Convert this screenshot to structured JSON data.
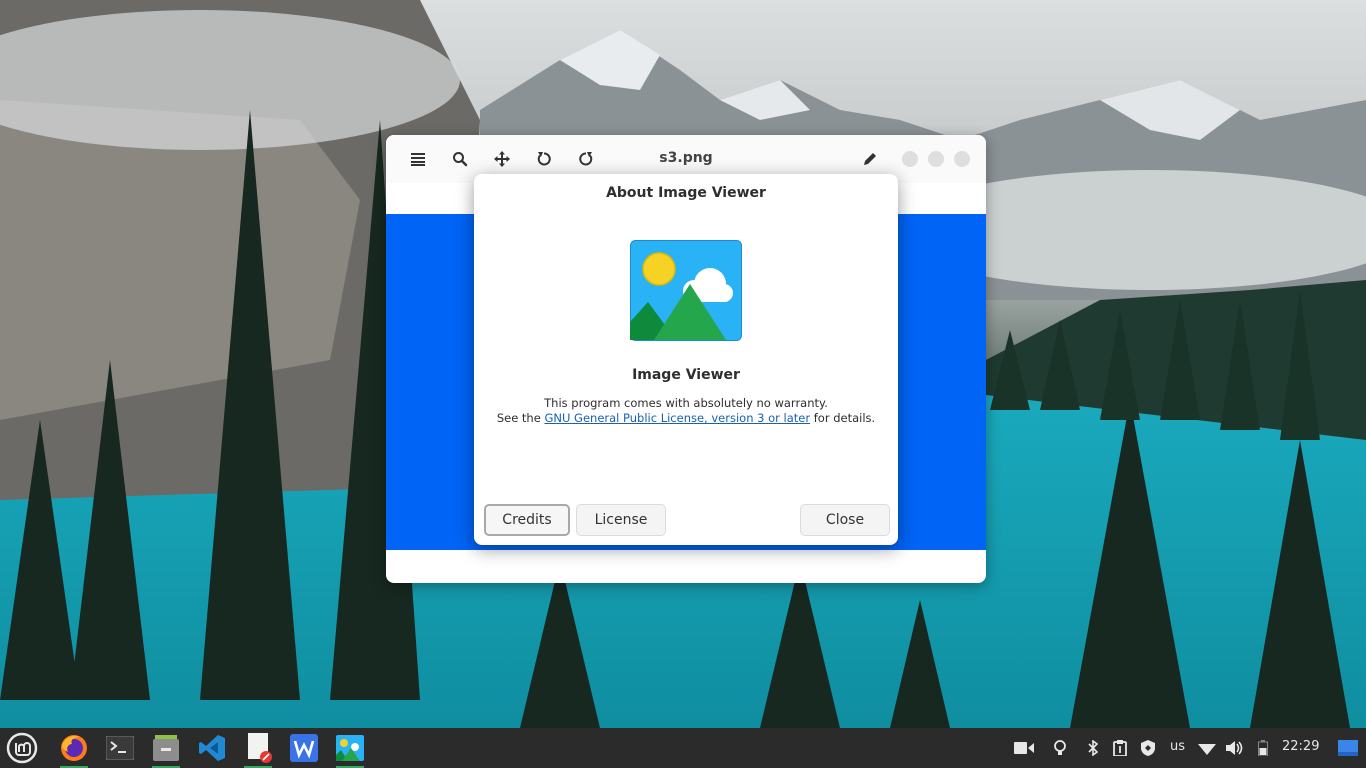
{
  "viewer": {
    "title": "s3.png",
    "toolbar": [
      "menu-icon",
      "search-icon",
      "move-icon",
      "rotate-left-icon",
      "rotate-right-icon",
      "edit-icon"
    ],
    "canvas_color": "#0064f6"
  },
  "about_dialog": {
    "title": "About Image Viewer",
    "app_name": "Image Viewer",
    "warranty_line": "This program comes with absolutely no warranty.",
    "license_prefix": "See the ",
    "license_link": "GNU General Public License, version 3 or later",
    "license_suffix": " for details.",
    "buttons": {
      "credits": "Credits",
      "license": "License",
      "close": "Close"
    }
  },
  "taskbar": {
    "apps": [
      "linux-mint-menu-icon",
      "firefox-icon",
      "terminal-icon",
      "files-icon",
      "vscode-icon",
      "text-editor-icon",
      "wps-writer-icon",
      "image-viewer-icon"
    ],
    "tray": {
      "keyboard_layout": "us",
      "clock": "22:29"
    }
  },
  "colors": {
    "accent_link": "#1a5fb4",
    "taskbar_bg": "#2b2b2b",
    "running_indicator": "#35a85f"
  }
}
